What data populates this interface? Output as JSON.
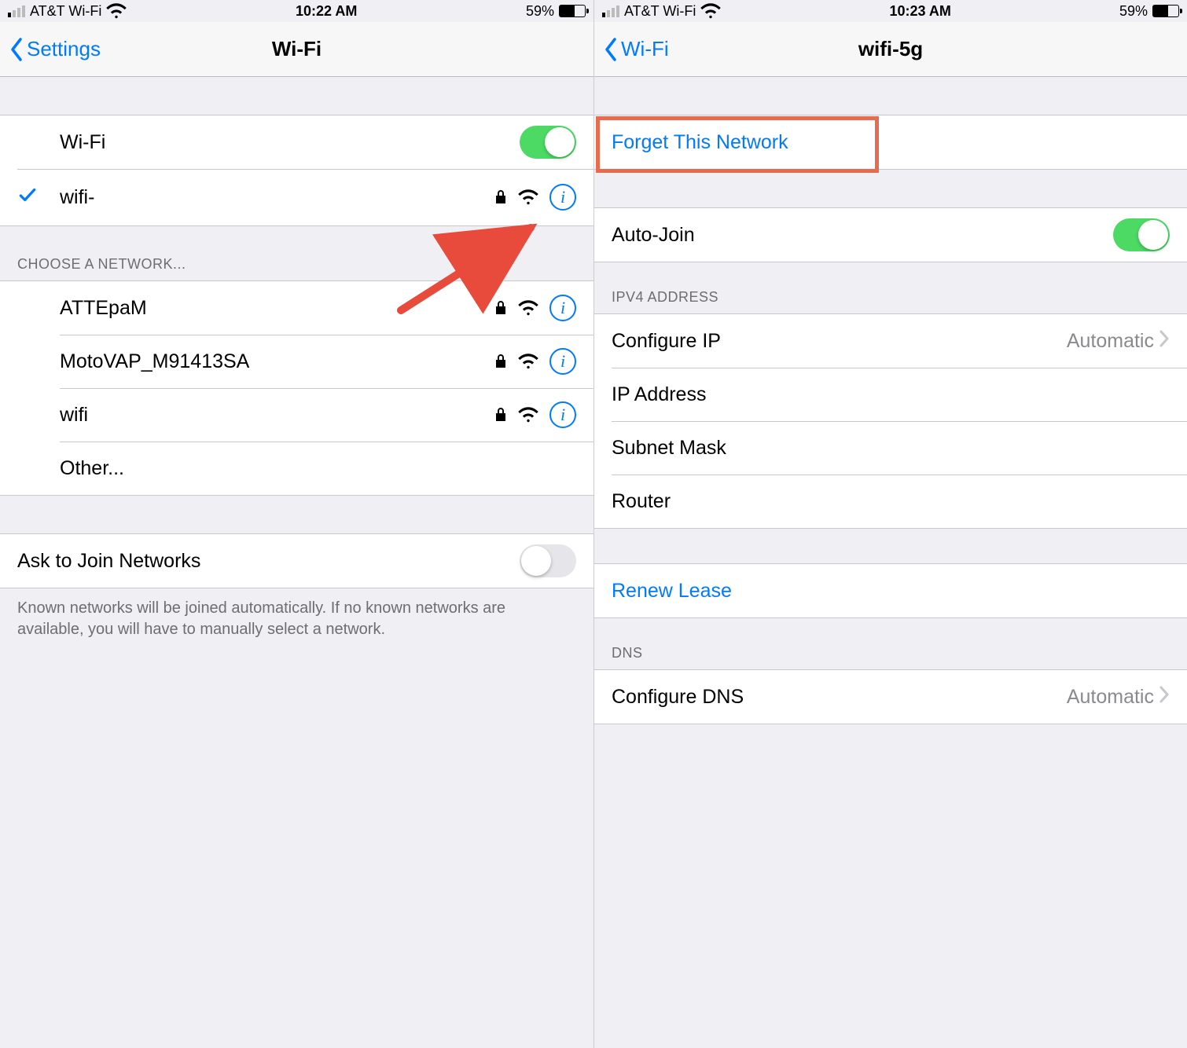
{
  "left": {
    "status": {
      "carrier": "AT&T Wi-Fi",
      "time": "10:22 AM",
      "battery_pct": "59%",
      "battery_fill": 59
    },
    "nav": {
      "back": "Settings",
      "title": "Wi-Fi"
    },
    "wifi_toggle_label": "Wi-Fi",
    "wifi_toggle_on": true,
    "connected": {
      "name": "wifi-",
      "secured": true
    },
    "choose_header": "CHOOSE A NETWORK...",
    "networks": [
      {
        "name": "ATTEpaM",
        "secured": true
      },
      {
        "name": "MotoVAP_M91413SA",
        "secured": true
      },
      {
        "name": "wifi",
        "secured": true
      }
    ],
    "other_label": "Other...",
    "ask_label": "Ask to Join Networks",
    "ask_on": false,
    "ask_footer": "Known networks will be joined automatically. If no known networks are available, you will have to manually select a network."
  },
  "right": {
    "status": {
      "carrier": "AT&T Wi-Fi",
      "time": "10:23 AM",
      "battery_pct": "59%",
      "battery_fill": 59
    },
    "nav": {
      "back": "Wi-Fi",
      "title": "wifi-5g"
    },
    "forget_label": "Forget This Network",
    "autojoin_label": "Auto-Join",
    "autojoin_on": true,
    "ipv4_header": "IPV4 ADDRESS",
    "configure_ip_label": "Configure IP",
    "configure_ip_value": "Automatic",
    "ip_address_label": "IP Address",
    "subnet_label": "Subnet Mask",
    "router_label": "Router",
    "renew_label": "Renew Lease",
    "dns_header": "DNS",
    "configure_dns_label": "Configure DNS",
    "configure_dns_value": "Automatic"
  }
}
